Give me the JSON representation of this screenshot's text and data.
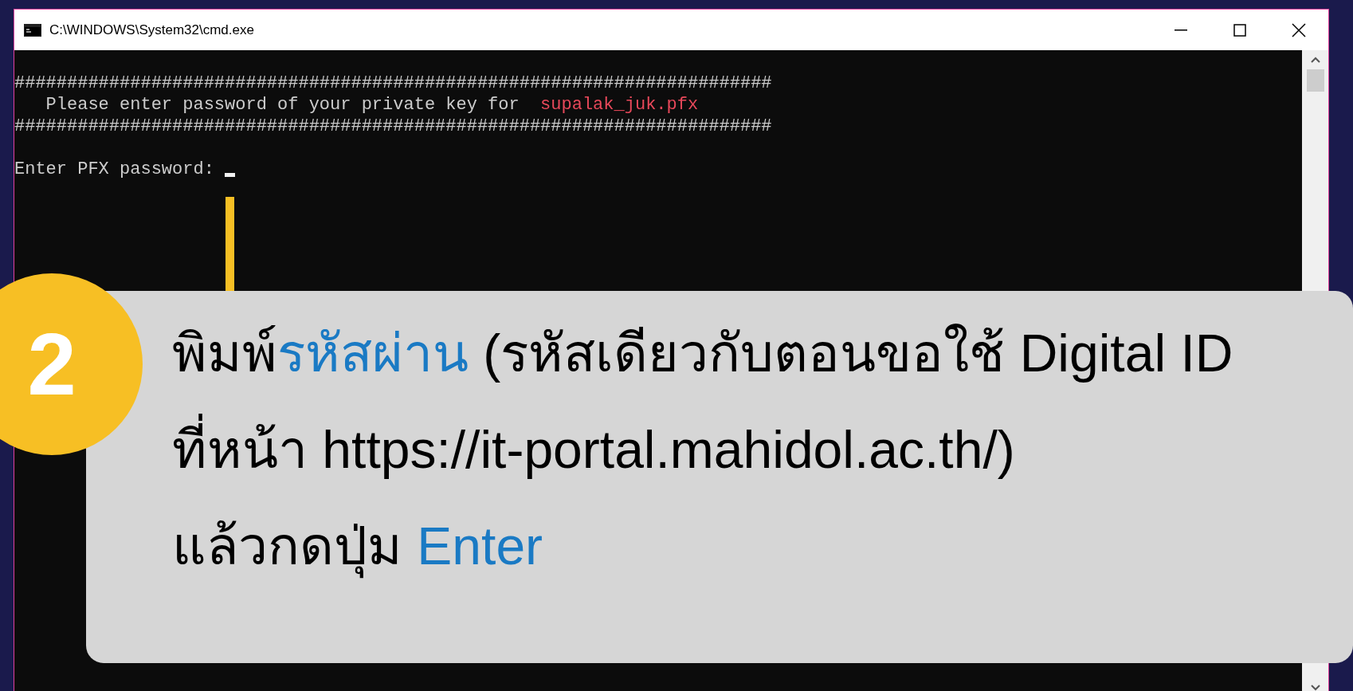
{
  "window": {
    "title": "C:\\WINDOWS\\System32\\cmd.exe"
  },
  "console": {
    "lines": [
      {
        "kind": "text",
        "segments": [
          {
            "text": "########################################################################",
            "highlight": false
          }
        ]
      },
      {
        "kind": "text",
        "segments": [
          {
            "text": "   Please enter password of your private key for  ",
            "highlight": false
          },
          {
            "text": "supalak_juk.pfx",
            "highlight": true
          }
        ]
      },
      {
        "kind": "text",
        "segments": [
          {
            "text": "########################################################################",
            "highlight": false
          }
        ]
      },
      {
        "kind": "blank"
      },
      {
        "kind": "prompt",
        "segments": [
          {
            "text": "Enter PFX password: ",
            "highlight": false
          }
        ]
      }
    ]
  },
  "callout": {
    "step": "2",
    "lines": [
      [
        {
          "text": "พิมพ์",
          "highlight": false
        },
        {
          "text": "รหัสผ่าน",
          "highlight": true
        },
        {
          "text": " (รหัสเดียวกับตอนขอใช้ Digital ID",
          "highlight": false
        }
      ],
      [
        {
          "text": "ที่หน้า https://it-portal.mahidol.ac.th/)",
          "highlight": false
        }
      ],
      [
        {
          "text": "แล้วกดปุ่ม ",
          "highlight": false
        },
        {
          "text": "Enter",
          "highlight": true
        }
      ]
    ]
  }
}
